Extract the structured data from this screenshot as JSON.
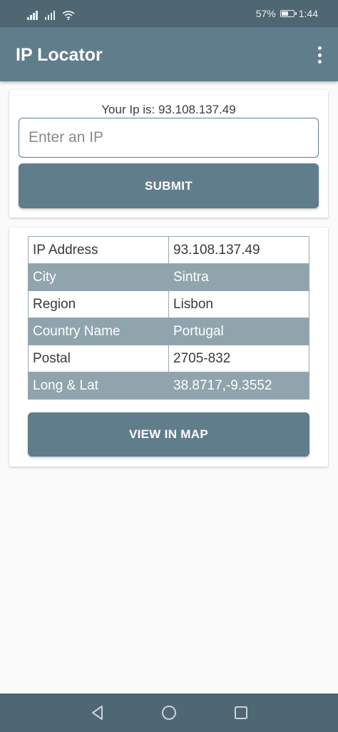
{
  "status_bar": {
    "battery_percent": "57%",
    "battery_level": 0.57,
    "time": "1:44",
    "icons": [
      "signal-icon",
      "signal-icon",
      "wifi-icon",
      "battery-icon"
    ]
  },
  "app_bar": {
    "title": "IP Locator",
    "menu_icon": "more-vertical-icon"
  },
  "lookup": {
    "ip_line": "Your Ip is: 93.108.137.49",
    "input_value": "",
    "input_placeholder": "Enter an IP",
    "submit_label": "SUBMIT"
  },
  "details": {
    "rows": [
      {
        "label": "IP Address",
        "value": "93.108.137.49"
      },
      {
        "label": "City",
        "value": "Sintra"
      },
      {
        "label": "Region",
        "value": "Lisbon"
      },
      {
        "label": "Country Name",
        "value": "Portugal"
      },
      {
        "label": "Postal",
        "value": "2705-832"
      },
      {
        "label": "Long & Lat",
        "value": "38.8717,-9.3552"
      }
    ],
    "map_button_label": "VIEW IN MAP"
  },
  "nav_bar": {
    "icons": [
      "back-icon",
      "home-icon",
      "recent-apps-icon"
    ]
  },
  "colors": {
    "primary": "#607d8b",
    "primary_dark": "#4f6773",
    "row_shade": "#90a4ae",
    "background": "#fafafa"
  }
}
